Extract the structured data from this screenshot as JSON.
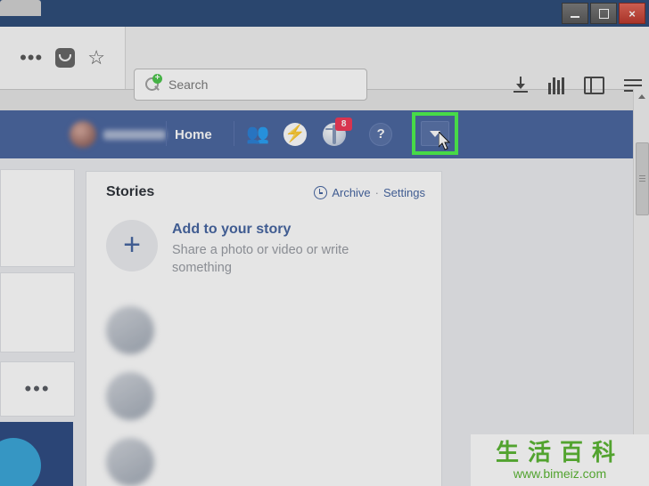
{
  "window": {
    "minimize_label": "Minimize",
    "maximize_label": "Maximize",
    "close_label": "×"
  },
  "browser": {
    "left_icons": [
      {
        "name": "more-dots-icon",
        "glyph": "•••"
      },
      {
        "name": "pocket-icon",
        "glyph": ""
      },
      {
        "name": "bookmark-star-icon",
        "glyph": "☆"
      }
    ],
    "search": {
      "placeholder": "Search",
      "value": "",
      "icon": "search-plus-icon"
    },
    "right_icons": [
      {
        "name": "downloads-icon"
      },
      {
        "name": "library-icon"
      },
      {
        "name": "sidebar-icon"
      },
      {
        "name": "hamburger-menu-icon"
      }
    ]
  },
  "facebook": {
    "brand_color": "#3b5998",
    "home_label": "Home",
    "friend_requests_icon": "friends-icon",
    "messenger_icon": "messenger-icon",
    "notifications_icon": "globe-notifications-icon",
    "notifications_badge": "8",
    "help_icon_label": "?",
    "account_menu_caret": "▼",
    "highlight_color": "#3ff23f"
  },
  "stories": {
    "title": "Stories",
    "archive_label": "Archive",
    "separator": "·",
    "settings_label": "Settings",
    "add_title": "Add to your story",
    "add_subtitle": "Share a photo or video or write something",
    "plus_glyph": "+",
    "items": [
      {
        "name": "story-item-1"
      },
      {
        "name": "story-item-2"
      },
      {
        "name": "story-item-3"
      }
    ]
  },
  "left_column": {
    "more_dots": "•••"
  },
  "watermark": {
    "chinese": "生活百科",
    "url": "www.bimeiz.com"
  }
}
